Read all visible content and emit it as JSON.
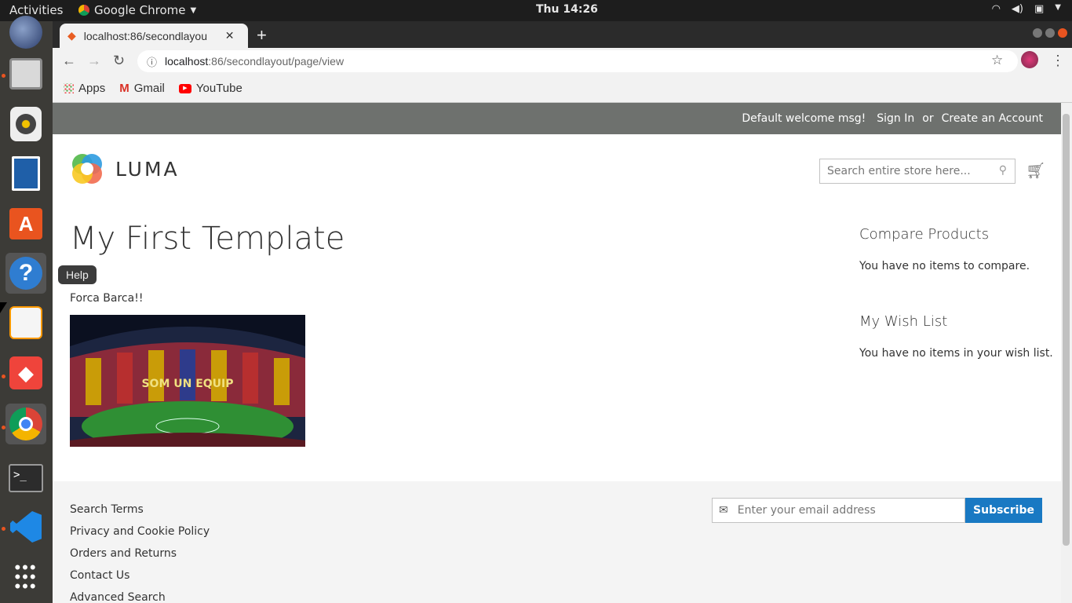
{
  "os": {
    "activities": "Activities",
    "app_name": "Google Chrome",
    "clock": "Thu 14:26",
    "tooltip": "Help"
  },
  "browser": {
    "tab_title": "localhost:86/secondlayou",
    "url_host": "localhost",
    "url_path": ":86/secondlayout/page/view",
    "bookmarks": [
      "Apps",
      "Gmail",
      "YouTube"
    ]
  },
  "site": {
    "welcome": "Default welcome msg!",
    "sign_in": "Sign In",
    "or": "or",
    "create_account": "Create an Account",
    "logo_text": "LUMA",
    "search_placeholder": "Search entire store here...",
    "page_title": "My First Template",
    "body_text": "Forca Barca!!",
    "stadium_banner": "SOM UN EQUIP",
    "compare_title": "Compare Products",
    "compare_text": "You have no items to compare.",
    "wishlist_title": "My Wish List",
    "wishlist_text": "You have no items in your wish list.",
    "footer_links": [
      "Search Terms",
      "Privacy and Cookie Policy",
      "Orders and Returns",
      "Contact Us",
      "Advanced Search"
    ],
    "newsletter_placeholder": "Enter your email address",
    "subscribe_label": "Subscribe",
    "accent_color": "#1979c3"
  }
}
